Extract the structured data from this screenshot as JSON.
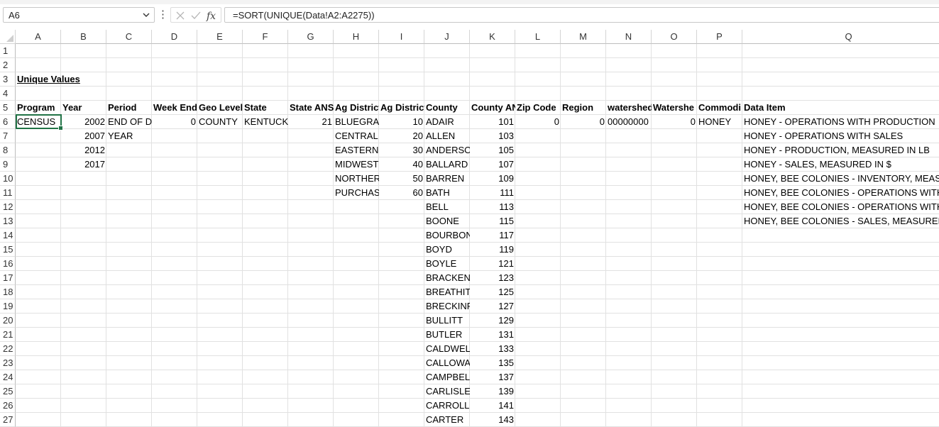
{
  "formula_bar": {
    "name_box": "A6",
    "more_icon": "vertical-dots-icon",
    "cancel_icon": "close-icon",
    "enter_icon": "checkmark-icon",
    "function_icon": "fx-icon",
    "formula": "=SORT(UNIQUE(Data!A2:A2275))"
  },
  "columns": [
    "A",
    "B",
    "C",
    "D",
    "E",
    "F",
    "G",
    "H",
    "I",
    "J",
    "K",
    "L",
    "M",
    "N",
    "O",
    "P",
    "Q"
  ],
  "rows": [
    "1",
    "2",
    "3",
    "4",
    "5",
    "6",
    "7",
    "8",
    "9",
    "10",
    "11",
    "12",
    "13",
    "14",
    "15",
    "16",
    "17",
    "18",
    "19",
    "20",
    "21",
    "22",
    "23",
    "24",
    "25",
    "26",
    "27"
  ],
  "sheet": {
    "title": "Unique Values",
    "headers": [
      "Program",
      "Year",
      "Period",
      "Week End",
      "Geo Level",
      "State",
      "State ANS",
      "Ag District",
      "Ag District",
      "County",
      "County AN",
      "Zip Code",
      "Region",
      "watershed",
      "Watershe",
      "Commodi",
      "Data Item"
    ],
    "program": [
      "CENSUS"
    ],
    "year": [
      "2002",
      "2007",
      "2012",
      "2017"
    ],
    "period": [
      "END OF DE",
      "YEAR"
    ],
    "week_end": [
      "0"
    ],
    "geo_level": [
      "COUNTY"
    ],
    "state": [
      "KENTUCKY"
    ],
    "state_ansi": [
      "21"
    ],
    "ag_district": [
      "BLUEGRAS",
      "CENTRAL",
      "EASTERN (",
      "MIDWESTI",
      "NORTHERI",
      "PURCHASE"
    ],
    "ag_district_code": [
      "10",
      "20",
      "30",
      "40",
      "50",
      "60"
    ],
    "county": [
      "ADAIR",
      "ALLEN",
      "ANDERSO",
      "BALLARD",
      "BARREN",
      "BATH",
      "BELL",
      "BOONE",
      "BOURBON",
      "BOYD",
      "BOYLE",
      "BRACKEN",
      "BREATHIT",
      "BRECKINR",
      "BULLITT",
      "BUTLER",
      "CALDWELI",
      "CALLOWA",
      "CAMPBELI",
      "CARLISLE",
      "CARROLL",
      "CARTER"
    ],
    "county_ansi": [
      "101",
      "103",
      "105",
      "107",
      "109",
      "111",
      "113",
      "115",
      "117",
      "119",
      "121",
      "123",
      "125",
      "127",
      "129",
      "131",
      "133",
      "135",
      "137",
      "139",
      "141",
      "143"
    ],
    "zip_code": [
      "0"
    ],
    "region": [
      "0"
    ],
    "watershed_code": [
      "00000000"
    ],
    "watershed": [
      "0"
    ],
    "commodity": [
      "HONEY"
    ],
    "data_item": [
      "HONEY - OPERATIONS WITH PRODUCTION",
      "HONEY - OPERATIONS WITH SALES",
      "HONEY - PRODUCTION, MEASURED IN LB",
      "HONEY - SALES, MEASURED IN $",
      "HONEY, BEE COLONIES - INVENTORY, MEASUR",
      "HONEY, BEE COLONIES - OPERATIONS WITH IN",
      "HONEY, BEE COLONIES - OPERATIONS WITH S.",
      "HONEY, BEE COLONIES - SALES, MEASURED IN"
    ]
  }
}
